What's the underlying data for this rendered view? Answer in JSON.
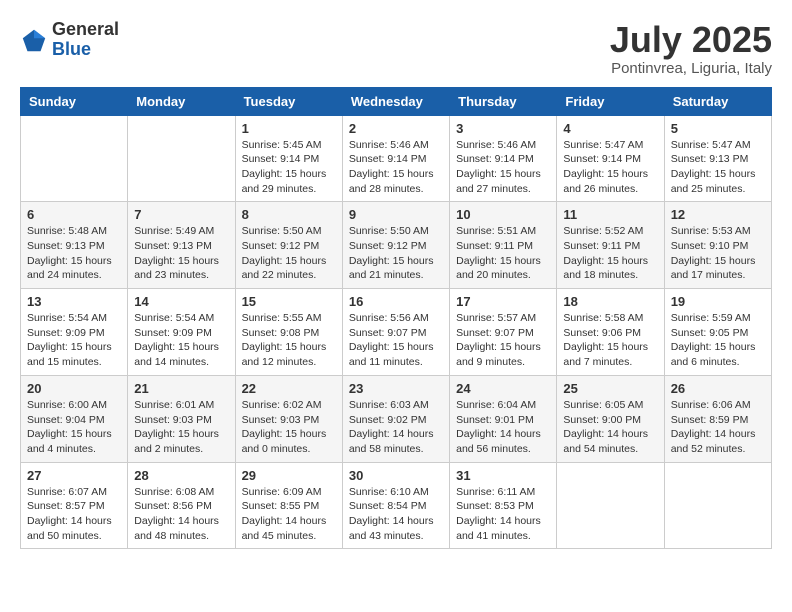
{
  "header": {
    "logo_general": "General",
    "logo_blue": "Blue",
    "month_title": "July 2025",
    "location": "Pontinvrea, Liguria, Italy"
  },
  "days_of_week": [
    "Sunday",
    "Monday",
    "Tuesday",
    "Wednesday",
    "Thursday",
    "Friday",
    "Saturday"
  ],
  "weeks": [
    [
      {
        "day": "",
        "info": ""
      },
      {
        "day": "",
        "info": ""
      },
      {
        "day": "1",
        "info": "Sunrise: 5:45 AM\nSunset: 9:14 PM\nDaylight: 15 hours\nand 29 minutes."
      },
      {
        "day": "2",
        "info": "Sunrise: 5:46 AM\nSunset: 9:14 PM\nDaylight: 15 hours\nand 28 minutes."
      },
      {
        "day": "3",
        "info": "Sunrise: 5:46 AM\nSunset: 9:14 PM\nDaylight: 15 hours\nand 27 minutes."
      },
      {
        "day": "4",
        "info": "Sunrise: 5:47 AM\nSunset: 9:14 PM\nDaylight: 15 hours\nand 26 minutes."
      },
      {
        "day": "5",
        "info": "Sunrise: 5:47 AM\nSunset: 9:13 PM\nDaylight: 15 hours\nand 25 minutes."
      }
    ],
    [
      {
        "day": "6",
        "info": "Sunrise: 5:48 AM\nSunset: 9:13 PM\nDaylight: 15 hours\nand 24 minutes."
      },
      {
        "day": "7",
        "info": "Sunrise: 5:49 AM\nSunset: 9:13 PM\nDaylight: 15 hours\nand 23 minutes."
      },
      {
        "day": "8",
        "info": "Sunrise: 5:50 AM\nSunset: 9:12 PM\nDaylight: 15 hours\nand 22 minutes."
      },
      {
        "day": "9",
        "info": "Sunrise: 5:50 AM\nSunset: 9:12 PM\nDaylight: 15 hours\nand 21 minutes."
      },
      {
        "day": "10",
        "info": "Sunrise: 5:51 AM\nSunset: 9:11 PM\nDaylight: 15 hours\nand 20 minutes."
      },
      {
        "day": "11",
        "info": "Sunrise: 5:52 AM\nSunset: 9:11 PM\nDaylight: 15 hours\nand 18 minutes."
      },
      {
        "day": "12",
        "info": "Sunrise: 5:53 AM\nSunset: 9:10 PM\nDaylight: 15 hours\nand 17 minutes."
      }
    ],
    [
      {
        "day": "13",
        "info": "Sunrise: 5:54 AM\nSunset: 9:09 PM\nDaylight: 15 hours\nand 15 minutes."
      },
      {
        "day": "14",
        "info": "Sunrise: 5:54 AM\nSunset: 9:09 PM\nDaylight: 15 hours\nand 14 minutes."
      },
      {
        "day": "15",
        "info": "Sunrise: 5:55 AM\nSunset: 9:08 PM\nDaylight: 15 hours\nand 12 minutes."
      },
      {
        "day": "16",
        "info": "Sunrise: 5:56 AM\nSunset: 9:07 PM\nDaylight: 15 hours\nand 11 minutes."
      },
      {
        "day": "17",
        "info": "Sunrise: 5:57 AM\nSunset: 9:07 PM\nDaylight: 15 hours\nand 9 minutes."
      },
      {
        "day": "18",
        "info": "Sunrise: 5:58 AM\nSunset: 9:06 PM\nDaylight: 15 hours\nand 7 minutes."
      },
      {
        "day": "19",
        "info": "Sunrise: 5:59 AM\nSunset: 9:05 PM\nDaylight: 15 hours\nand 6 minutes."
      }
    ],
    [
      {
        "day": "20",
        "info": "Sunrise: 6:00 AM\nSunset: 9:04 PM\nDaylight: 15 hours\nand 4 minutes."
      },
      {
        "day": "21",
        "info": "Sunrise: 6:01 AM\nSunset: 9:03 PM\nDaylight: 15 hours\nand 2 minutes."
      },
      {
        "day": "22",
        "info": "Sunrise: 6:02 AM\nSunset: 9:03 PM\nDaylight: 15 hours\nand 0 minutes."
      },
      {
        "day": "23",
        "info": "Sunrise: 6:03 AM\nSunset: 9:02 PM\nDaylight: 14 hours\nand 58 minutes."
      },
      {
        "day": "24",
        "info": "Sunrise: 6:04 AM\nSunset: 9:01 PM\nDaylight: 14 hours\nand 56 minutes."
      },
      {
        "day": "25",
        "info": "Sunrise: 6:05 AM\nSunset: 9:00 PM\nDaylight: 14 hours\nand 54 minutes."
      },
      {
        "day": "26",
        "info": "Sunrise: 6:06 AM\nSunset: 8:59 PM\nDaylight: 14 hours\nand 52 minutes."
      }
    ],
    [
      {
        "day": "27",
        "info": "Sunrise: 6:07 AM\nSunset: 8:57 PM\nDaylight: 14 hours\nand 50 minutes."
      },
      {
        "day": "28",
        "info": "Sunrise: 6:08 AM\nSunset: 8:56 PM\nDaylight: 14 hours\nand 48 minutes."
      },
      {
        "day": "29",
        "info": "Sunrise: 6:09 AM\nSunset: 8:55 PM\nDaylight: 14 hours\nand 45 minutes."
      },
      {
        "day": "30",
        "info": "Sunrise: 6:10 AM\nSunset: 8:54 PM\nDaylight: 14 hours\nand 43 minutes."
      },
      {
        "day": "31",
        "info": "Sunrise: 6:11 AM\nSunset: 8:53 PM\nDaylight: 14 hours\nand 41 minutes."
      },
      {
        "day": "",
        "info": ""
      },
      {
        "day": "",
        "info": ""
      }
    ]
  ]
}
